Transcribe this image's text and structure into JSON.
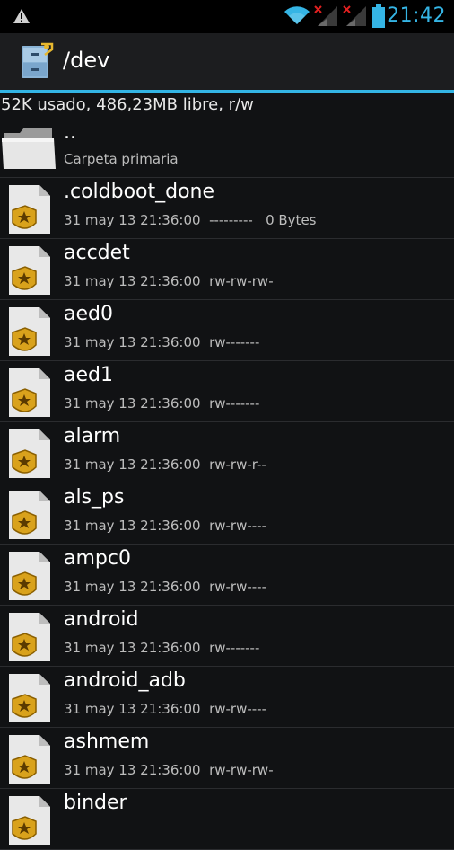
{
  "status_bar": {
    "time": "21:42",
    "icons": [
      "warning-icon",
      "wifi-icon",
      "signal-no-sim-1-icon",
      "signal-no-sim-2-icon",
      "battery-icon"
    ],
    "accent_color": "#35b5e5"
  },
  "action_bar": {
    "path": "/dev",
    "app_icon": "file-cabinet-icon"
  },
  "storage_info": "52K usado, 486,23MB libre, r/w",
  "parent_entry": {
    "name": "..",
    "subtitle": "Carpeta primaria",
    "icon": "folder-icon"
  },
  "files": [
    {
      "name": ".coldboot_done",
      "date": "31 may 13 21:36:00",
      "perms": "---------",
      "size": "0 Bytes"
    },
    {
      "name": "accdet",
      "date": "31 may 13 21:36:00",
      "perms": "rw-rw-rw-",
      "size": ""
    },
    {
      "name": "aed0",
      "date": "31 may 13 21:36:00",
      "perms": "rw-------",
      "size": ""
    },
    {
      "name": "aed1",
      "date": "31 may 13 21:36:00",
      "perms": "rw-------",
      "size": ""
    },
    {
      "name": "alarm",
      "date": "31 may 13 21:36:00",
      "perms": "rw-rw-r--",
      "size": ""
    },
    {
      "name": "als_ps",
      "date": "31 may 13 21:36:00",
      "perms": "rw-rw----",
      "size": ""
    },
    {
      "name": "ampc0",
      "date": "31 may 13 21:36:00",
      "perms": "rw-rw----",
      "size": ""
    },
    {
      "name": "android",
      "date": "31 may 13 21:36:00",
      "perms": "rw-------",
      "size": ""
    },
    {
      "name": "android_adb",
      "date": "31 may 13 21:36:00",
      "perms": "rw-rw----",
      "size": ""
    },
    {
      "name": "ashmem",
      "date": "31 may 13 21:36:00",
      "perms": "rw-rw-rw-",
      "size": ""
    },
    {
      "name": "binder",
      "date": "",
      "perms": "",
      "size": ""
    }
  ],
  "file_icon": "system-file-icon"
}
